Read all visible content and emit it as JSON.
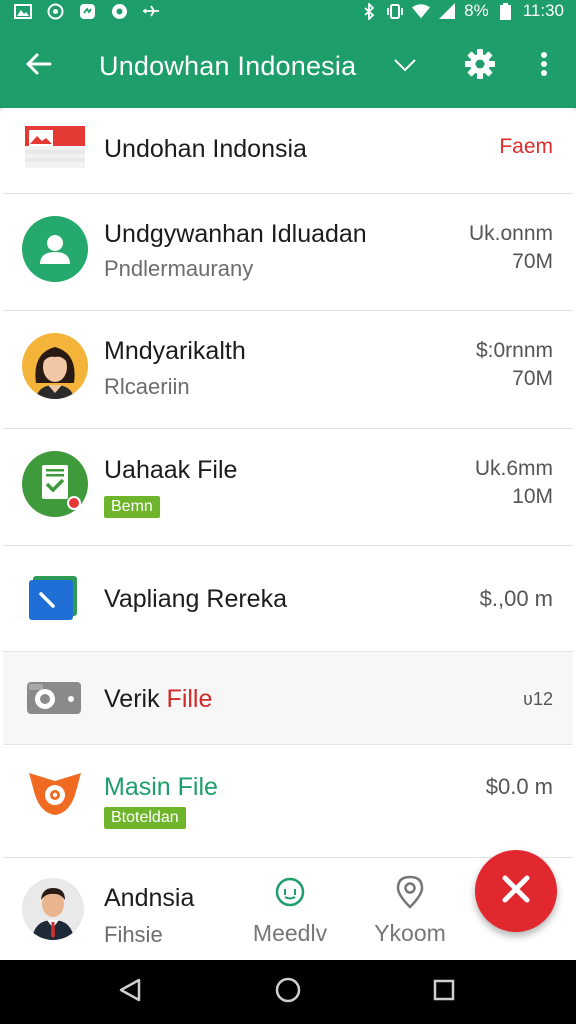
{
  "status_bar": {
    "time": "11:30",
    "battery": "8%",
    "left_icons": [
      "gallery-icon",
      "whatsapp-icon",
      "messenger-icon",
      "chat-icon",
      "airplane-icon"
    ],
    "right_icons": [
      "bluetooth-icon",
      "vibrate-icon",
      "wifi-icon",
      "signal-icon",
      "battery-icon"
    ]
  },
  "app_bar": {
    "title": "Undowhan Indonesia",
    "icons": [
      "back-arrow-icon",
      "chevron-down-icon",
      "gear-icon",
      "more-vert-icon"
    ]
  },
  "rows": [
    {
      "title": "Undohan Indonsia",
      "meta1": "Faem",
      "avatar": "indonesia-flag-icon"
    },
    {
      "title": "Undgywanhan Idluadan",
      "subtitle": "Pndlermaurany",
      "meta1": "Uk.onnm",
      "meta2": "70M",
      "avatar": "person-icon"
    },
    {
      "title": "Mndyarikalth",
      "subtitle": "Rlcaeriin",
      "meta1": "$:0rnnm",
      "meta2": "70M",
      "avatar": "woman-avatar-icon"
    },
    {
      "title": "Uahaak File",
      "badge": "Bemn",
      "meta1": "Uk.6mm",
      "meta2": "10M",
      "avatar": "document-check-icon"
    },
    {
      "title": "Vapliang Rereka",
      "meta1": "$.,00 m",
      "avatar": "folder-icon"
    },
    {
      "title_part1": "Verik",
      "title_part2": "Fille",
      "meta1": "ʋ12",
      "avatar": "camera-icon"
    },
    {
      "title": "Masin File",
      "badge": "Btoteldan",
      "meta1": "$0.0 m",
      "avatar": "orange-logo-icon"
    }
  ],
  "bottom": {
    "profile_title": "Andnsia",
    "profile_sub": "Fihsie",
    "nav": [
      {
        "label": "Meedlv",
        "icon": "chat-bubble-icon"
      },
      {
        "label": "Ykoom",
        "icon": "location-pin-icon"
      }
    ],
    "fab_icon": "close-icon"
  },
  "colors": {
    "primary": "#1e9e6a",
    "accent_red": "#e0282e",
    "badge_green": "#6fb52c",
    "green_text": "#1e9e6a"
  }
}
